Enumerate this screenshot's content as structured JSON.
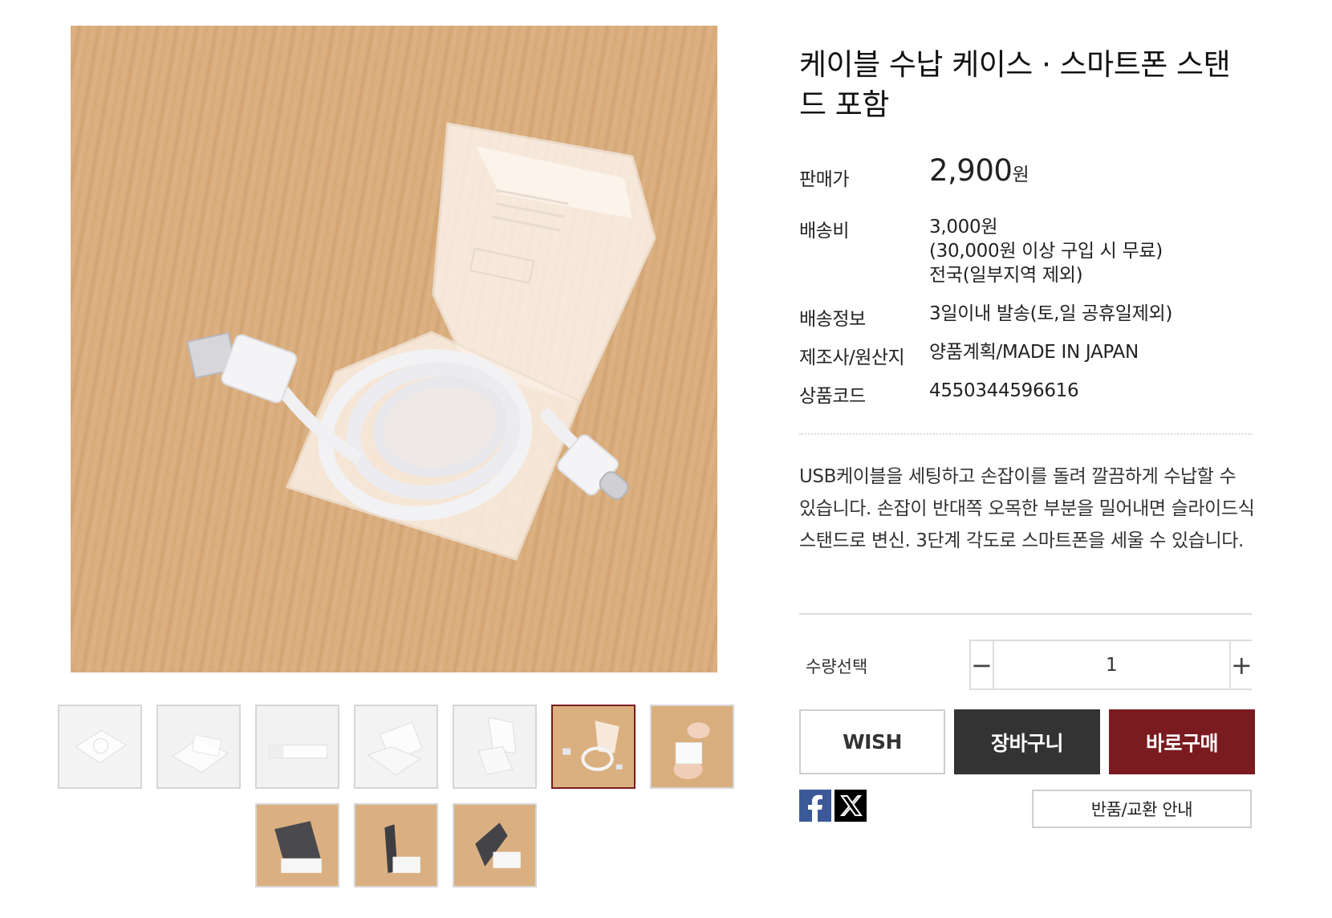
{
  "product": {
    "title": "케이블 수납 케이스 · 스마트폰 스탠드 포함",
    "main_image_icon": "cable-case-photo",
    "price_label": "판매가",
    "price_value": "2,900",
    "price_unit": "원",
    "shipping_label": "배송비",
    "shipping_line1": "3,000원",
    "shipping_line2": "(30,000원 이상 구입 시 무료)",
    "shipping_line3": "전국(일부지역 제외)",
    "delivery_label": "배송정보",
    "delivery_value": "3일이내 발송(토,일 공휴일제외)",
    "maker_label": "제조사/원산지",
    "maker_value": "양품계획/MADE IN JAPAN",
    "code_label": "상품코드",
    "code_value": "4550344596616",
    "description": "USB케이블을 세팅하고 손잡이를 돌려 깔끔하게 수납할 수 있습니다. 손잡이 반대쪽 오목한 부분을 밀어내면 슬라이드식 스탠드로 변신. 3단계 각도로 스마트폰을 세울 수 있습니다."
  },
  "quantity": {
    "label": "수량선택",
    "value": "1",
    "minus_symbol": "−",
    "plus_symbol": "+"
  },
  "buttons": {
    "wish": "WISH",
    "cart": "장바구니",
    "buy": "바로구매",
    "return_info": "반품/교환 안내"
  },
  "share": {
    "facebook_icon": "facebook-icon",
    "x_icon": "x-twitter-icon"
  },
  "thumbnails": {
    "count": 10,
    "active_index": 5
  },
  "colors": {
    "accent": "#7a1b1f",
    "dark_button": "#333333",
    "facebook": "#3b5998"
  }
}
